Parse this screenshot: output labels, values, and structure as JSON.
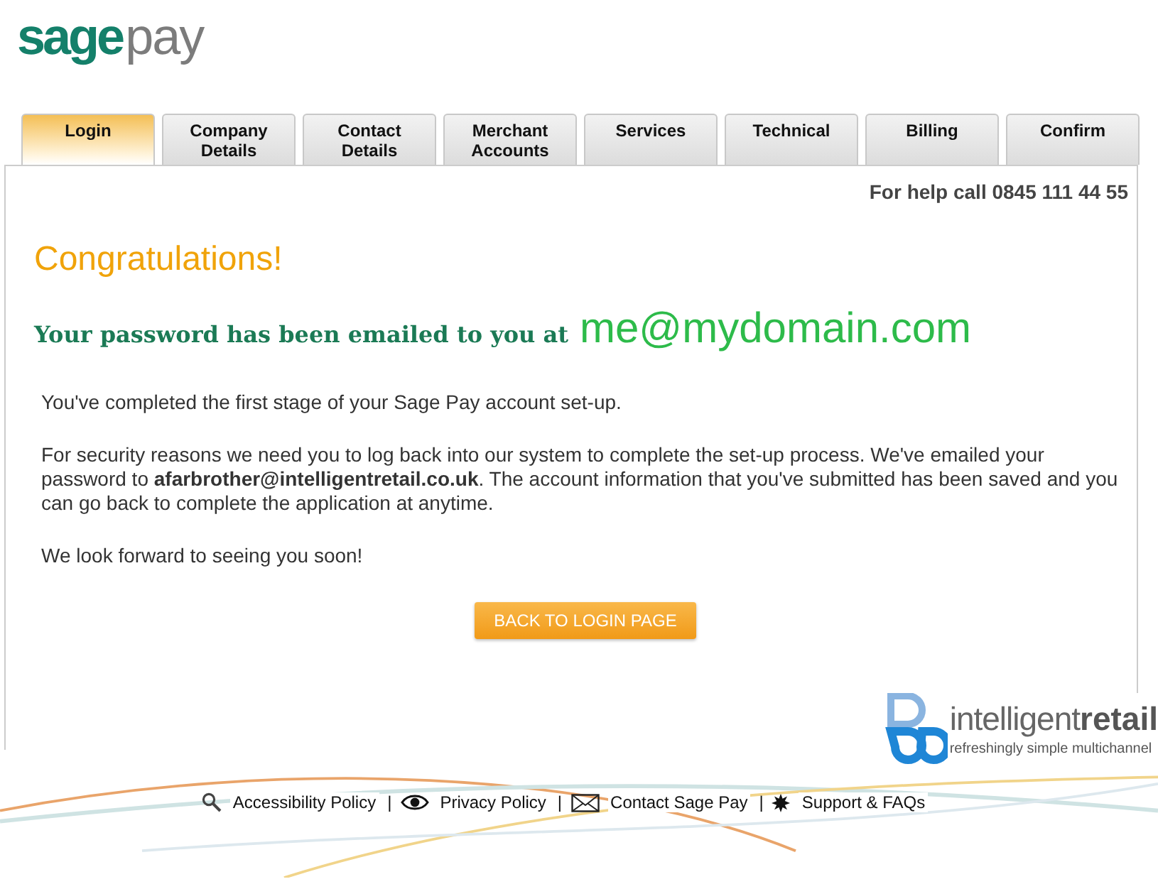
{
  "logo": {
    "part_1": "sage",
    "part_2": "pay"
  },
  "tabs": [
    {
      "lines": [
        "Login"
      ],
      "selected": true
    },
    {
      "lines": [
        "Company",
        "Details"
      ],
      "selected": false
    },
    {
      "lines": [
        "Contact",
        "Details"
      ],
      "selected": false
    },
    {
      "lines": [
        "Merchant",
        "Accounts"
      ],
      "selected": false
    },
    {
      "lines": [
        "Services"
      ],
      "selected": false
    },
    {
      "lines": [
        "Technical"
      ],
      "selected": false
    },
    {
      "lines": [
        "Billing"
      ],
      "selected": false
    },
    {
      "lines": [
        "Confirm"
      ],
      "selected": false
    }
  ],
  "help": "For help call 0845 111 44 55",
  "heading": "Congratulations!",
  "notice": {
    "text": "Your password has been emailed to you at",
    "email": "me@mydomain.com"
  },
  "paragraphs": [
    "You've completed the first stage of your Sage Pay account set-up.",
    "For security reasons we need you to log back into our system to complete the set-up process. We've emailed your password to **afarbrother@intelligentretail.co.uk**. The account information that you've submitted has been saved and you can go back to complete the application at anytime.",
    "We look forward to seeing you soon!"
  ],
  "button": "BACK TO LOGIN PAGE",
  "partner": {
    "name_1": "intelligent",
    "name_2": "retail",
    "tagline": "refreshingly simple multichannel"
  },
  "footer_links": [
    {
      "kind": "search",
      "label": "Accessibility Policy"
    },
    {
      "kind": "eye",
      "label": "Privacy Policy"
    },
    {
      "kind": "mail",
      "label": "Contact Sage Pay"
    },
    {
      "kind": "star",
      "label": "Support & FAQs"
    }
  ],
  "separator": "|"
}
